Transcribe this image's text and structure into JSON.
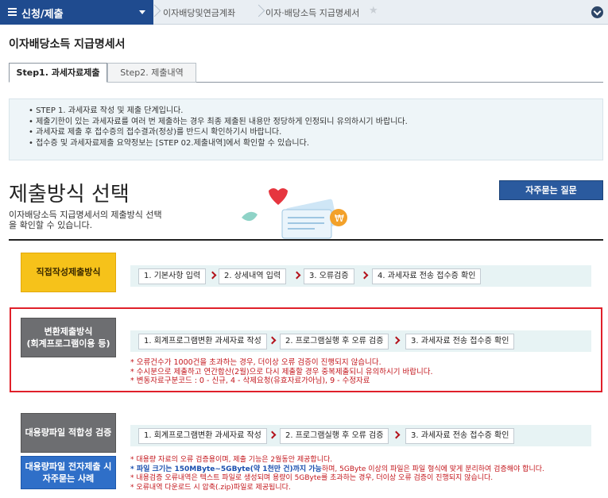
{
  "nav": {
    "menu_label": "신청/제출",
    "crumbs": [
      "이자배당및연금계좌",
      "이자·배당소득 지급명세서"
    ]
  },
  "page_title": "이자배당소득 지급명세서",
  "tabs": [
    {
      "label": "Step1. 과세자료제출",
      "active": true
    },
    {
      "label": "Step2. 제출내역",
      "active": false
    }
  ],
  "info_lines": [
    "• STEP 1. 과세자료 작성 및 제출 단계입니다.",
    "• 제출기한이 있는 과세자료를 여러 번 제출하는 경우 최종 제출된 내용만 정당하게 인정되니 유의하시기 바랍니다.",
    "• 과세자료 제출 후 접수증의 접수결과(정상)를 반드시 확인하기시 바랍니다.",
    "• 접수증 및 과세자료제출 요약정보는 [STEP 02.제출내역]에서 확인할 수 있습니다."
  ],
  "section": {
    "title": "제출방식 선택",
    "desc": "이자배당소득 지급명세서의 제출방식 선택을 확인할 수 있습니다.",
    "faq_label": "자주묻는 질문"
  },
  "methods": {
    "direct": {
      "label": "직접작성제출방식",
      "steps": [
        "1. 기본사항 입력",
        "2. 상세내역 입력",
        "3. 오류검증",
        "4. 과세자료 전송 접수증 확인"
      ]
    },
    "convert": {
      "label_1": "변환제출방식",
      "label_2": "(회계프로그램이용 등)",
      "steps": [
        "1. 회계프로그램변환 과세자료 작성",
        "2. 프로그램실행 후 오류 검증",
        "3. 과세자료 전송 접수증 확인"
      ],
      "notes": [
        "* 오류건수가 1000건을 초과하는 경우, 더이상 오류 검증이 진행되지 않습니다.",
        "* 수시분으로 제출하고 연간합산(2월)으로 다시 제출할 경우 중복제출되니 유의하시기 바랍니다.",
        "* 변동자료구분코드 : 0 - 신규, 4 - 삭제요청(유효자료가아님), 9 - 수정자료"
      ]
    },
    "bulk": {
      "label": "대용량파일 적합성 검증",
      "label2_1": "대용량파일 전자제출 시",
      "label2_2": "자주묻는 사례",
      "steps": [
        "1. 회계프로그램변환 과세자료 작성",
        "2. 프로그램실행 후 오류 검증",
        "3. 과세자료 전송 접수증 확인"
      ],
      "note1": "* 대용량 자료의 오류 검증용이며, 제출 기능은 2월동안 제공합니다.",
      "note2_blue": "* 파일 크기는 150MByte~5GByte(약 1천만 건)까지 가능",
      "note2_rest": "하며, 5GByte 이상의 파일은 파일 형식에 맞게 분리하여 검증해야 합니다.",
      "note3": "* 내용검증 오류내역은 텍스트 파일로 생성되며 용량이 5GByte를 초과하는 경우, 더이상 오류 검증이 진행되지 않습니다.",
      "note4": "* 오류내역 다운로드 시 압축(.zip)파일로 제공됩니다."
    }
  },
  "colors": {
    "nav_blue": "#1f4b8f",
    "highlight_red": "#e0202a",
    "note_red": "#c3161c"
  }
}
